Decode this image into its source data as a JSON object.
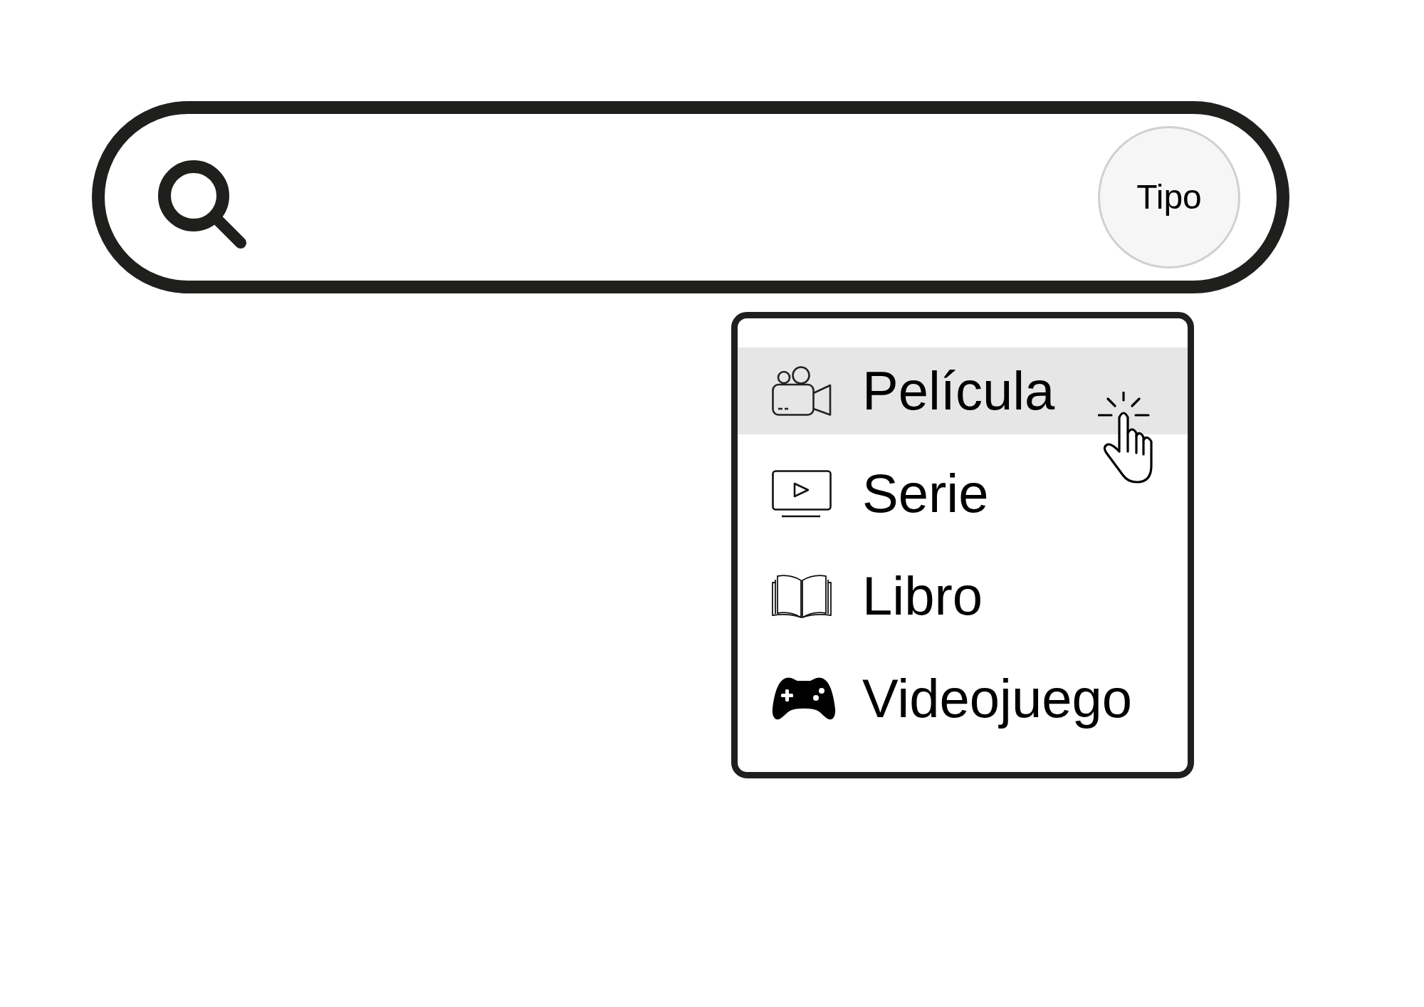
{
  "search_bar": {
    "type_button": {
      "label": "Tipo"
    }
  },
  "type_menu": {
    "items": [
      {
        "label": "Película",
        "selected": true
      },
      {
        "label": "Serie",
        "selected": false
      },
      {
        "label": "Libro",
        "selected": false
      },
      {
        "label": "Videojuego",
        "selected": false
      }
    ]
  }
}
